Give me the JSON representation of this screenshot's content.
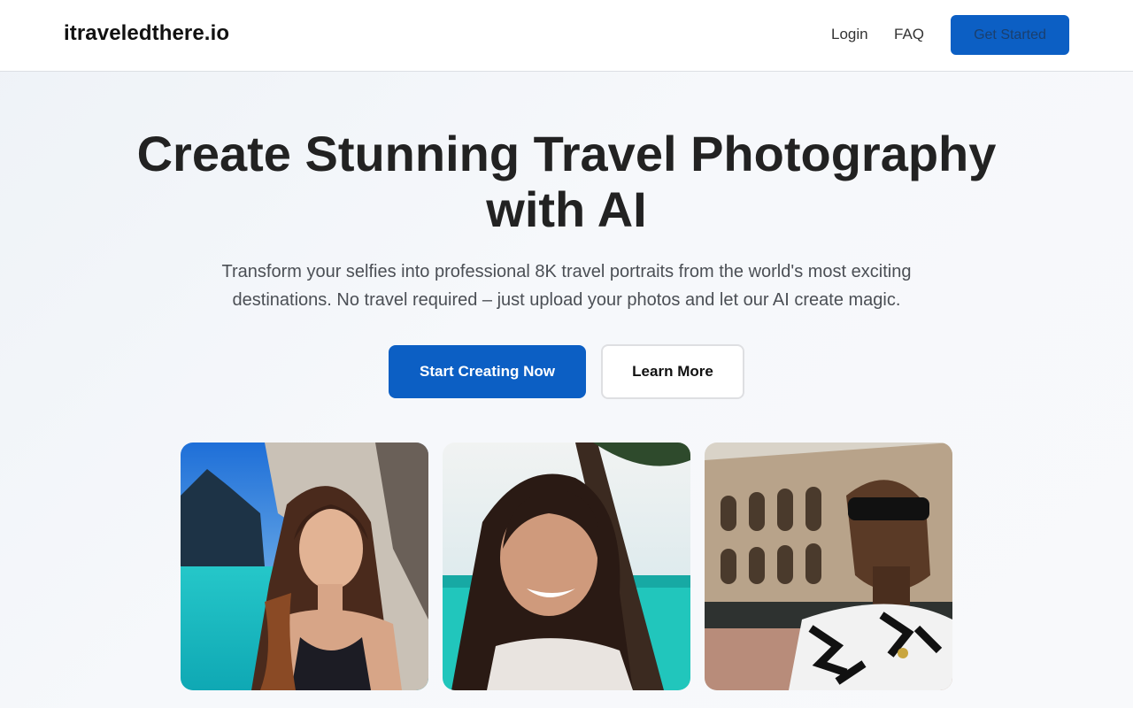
{
  "header": {
    "logo": "itraveledthere.io",
    "nav": {
      "login": "Login",
      "faq": "FAQ",
      "get_started": "Get Started"
    }
  },
  "hero": {
    "title_line1": "Create Stunning Travel Photography",
    "title_line2": "with AI",
    "subtitle_line1": "Transform your selfies into professional 8K travel portraits from the world's most exciting",
    "subtitle_line2": "destinations. No travel required – just upload your photos and let our AI create magic.",
    "primary_cta": "Start Creating Now",
    "secondary_cta": "Learn More"
  },
  "gallery": {
    "items": [
      {
        "icon": "portrait-beach-cliff-photo"
      },
      {
        "icon": "portrait-beach-palm-photo"
      },
      {
        "icon": "portrait-colosseum-photo"
      }
    ]
  },
  "colors": {
    "accent": "#0c5fc4",
    "text_dark": "#222222",
    "text_muted": "#4b4f55",
    "header_bg": "#ffffff"
  }
}
